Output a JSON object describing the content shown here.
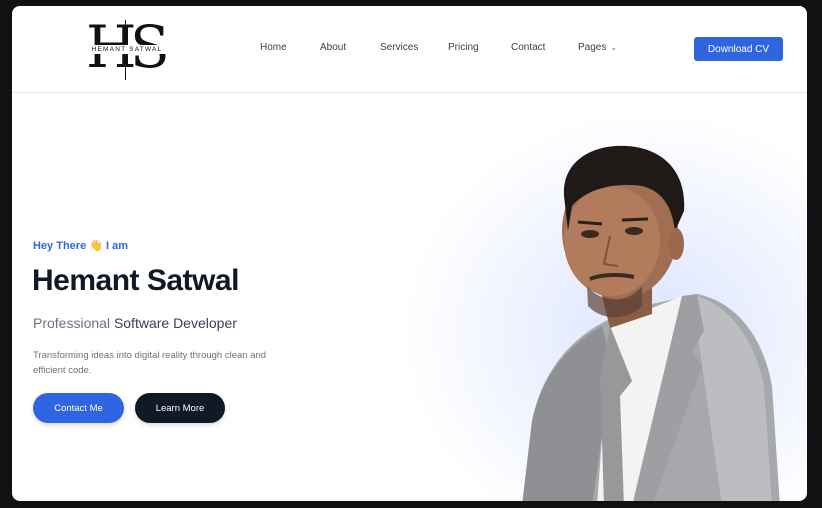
{
  "logo": {
    "big_left": "H",
    "big_right": "S",
    "sub": "HEMANT SATWAL"
  },
  "nav": {
    "items": [
      "Home",
      "About",
      "Services",
      "Pricing",
      "Contact",
      "Pages"
    ],
    "chevron_icon": "chevron-down-icon"
  },
  "header": {
    "cta_label": "Download CV"
  },
  "hero": {
    "greeting": "Hey There 👋 I am",
    "name": "Hemant Satwal",
    "role_muted": "Professional",
    "role_main": "Software Developer",
    "description": "Transforming ideas into digital reality through clean and efficient code.",
    "primary_button": "Contact Me",
    "secondary_button": "Learn More"
  },
  "colors": {
    "accent": "#2f66e0",
    "dark": "#111827",
    "background": "#ffffff"
  }
}
